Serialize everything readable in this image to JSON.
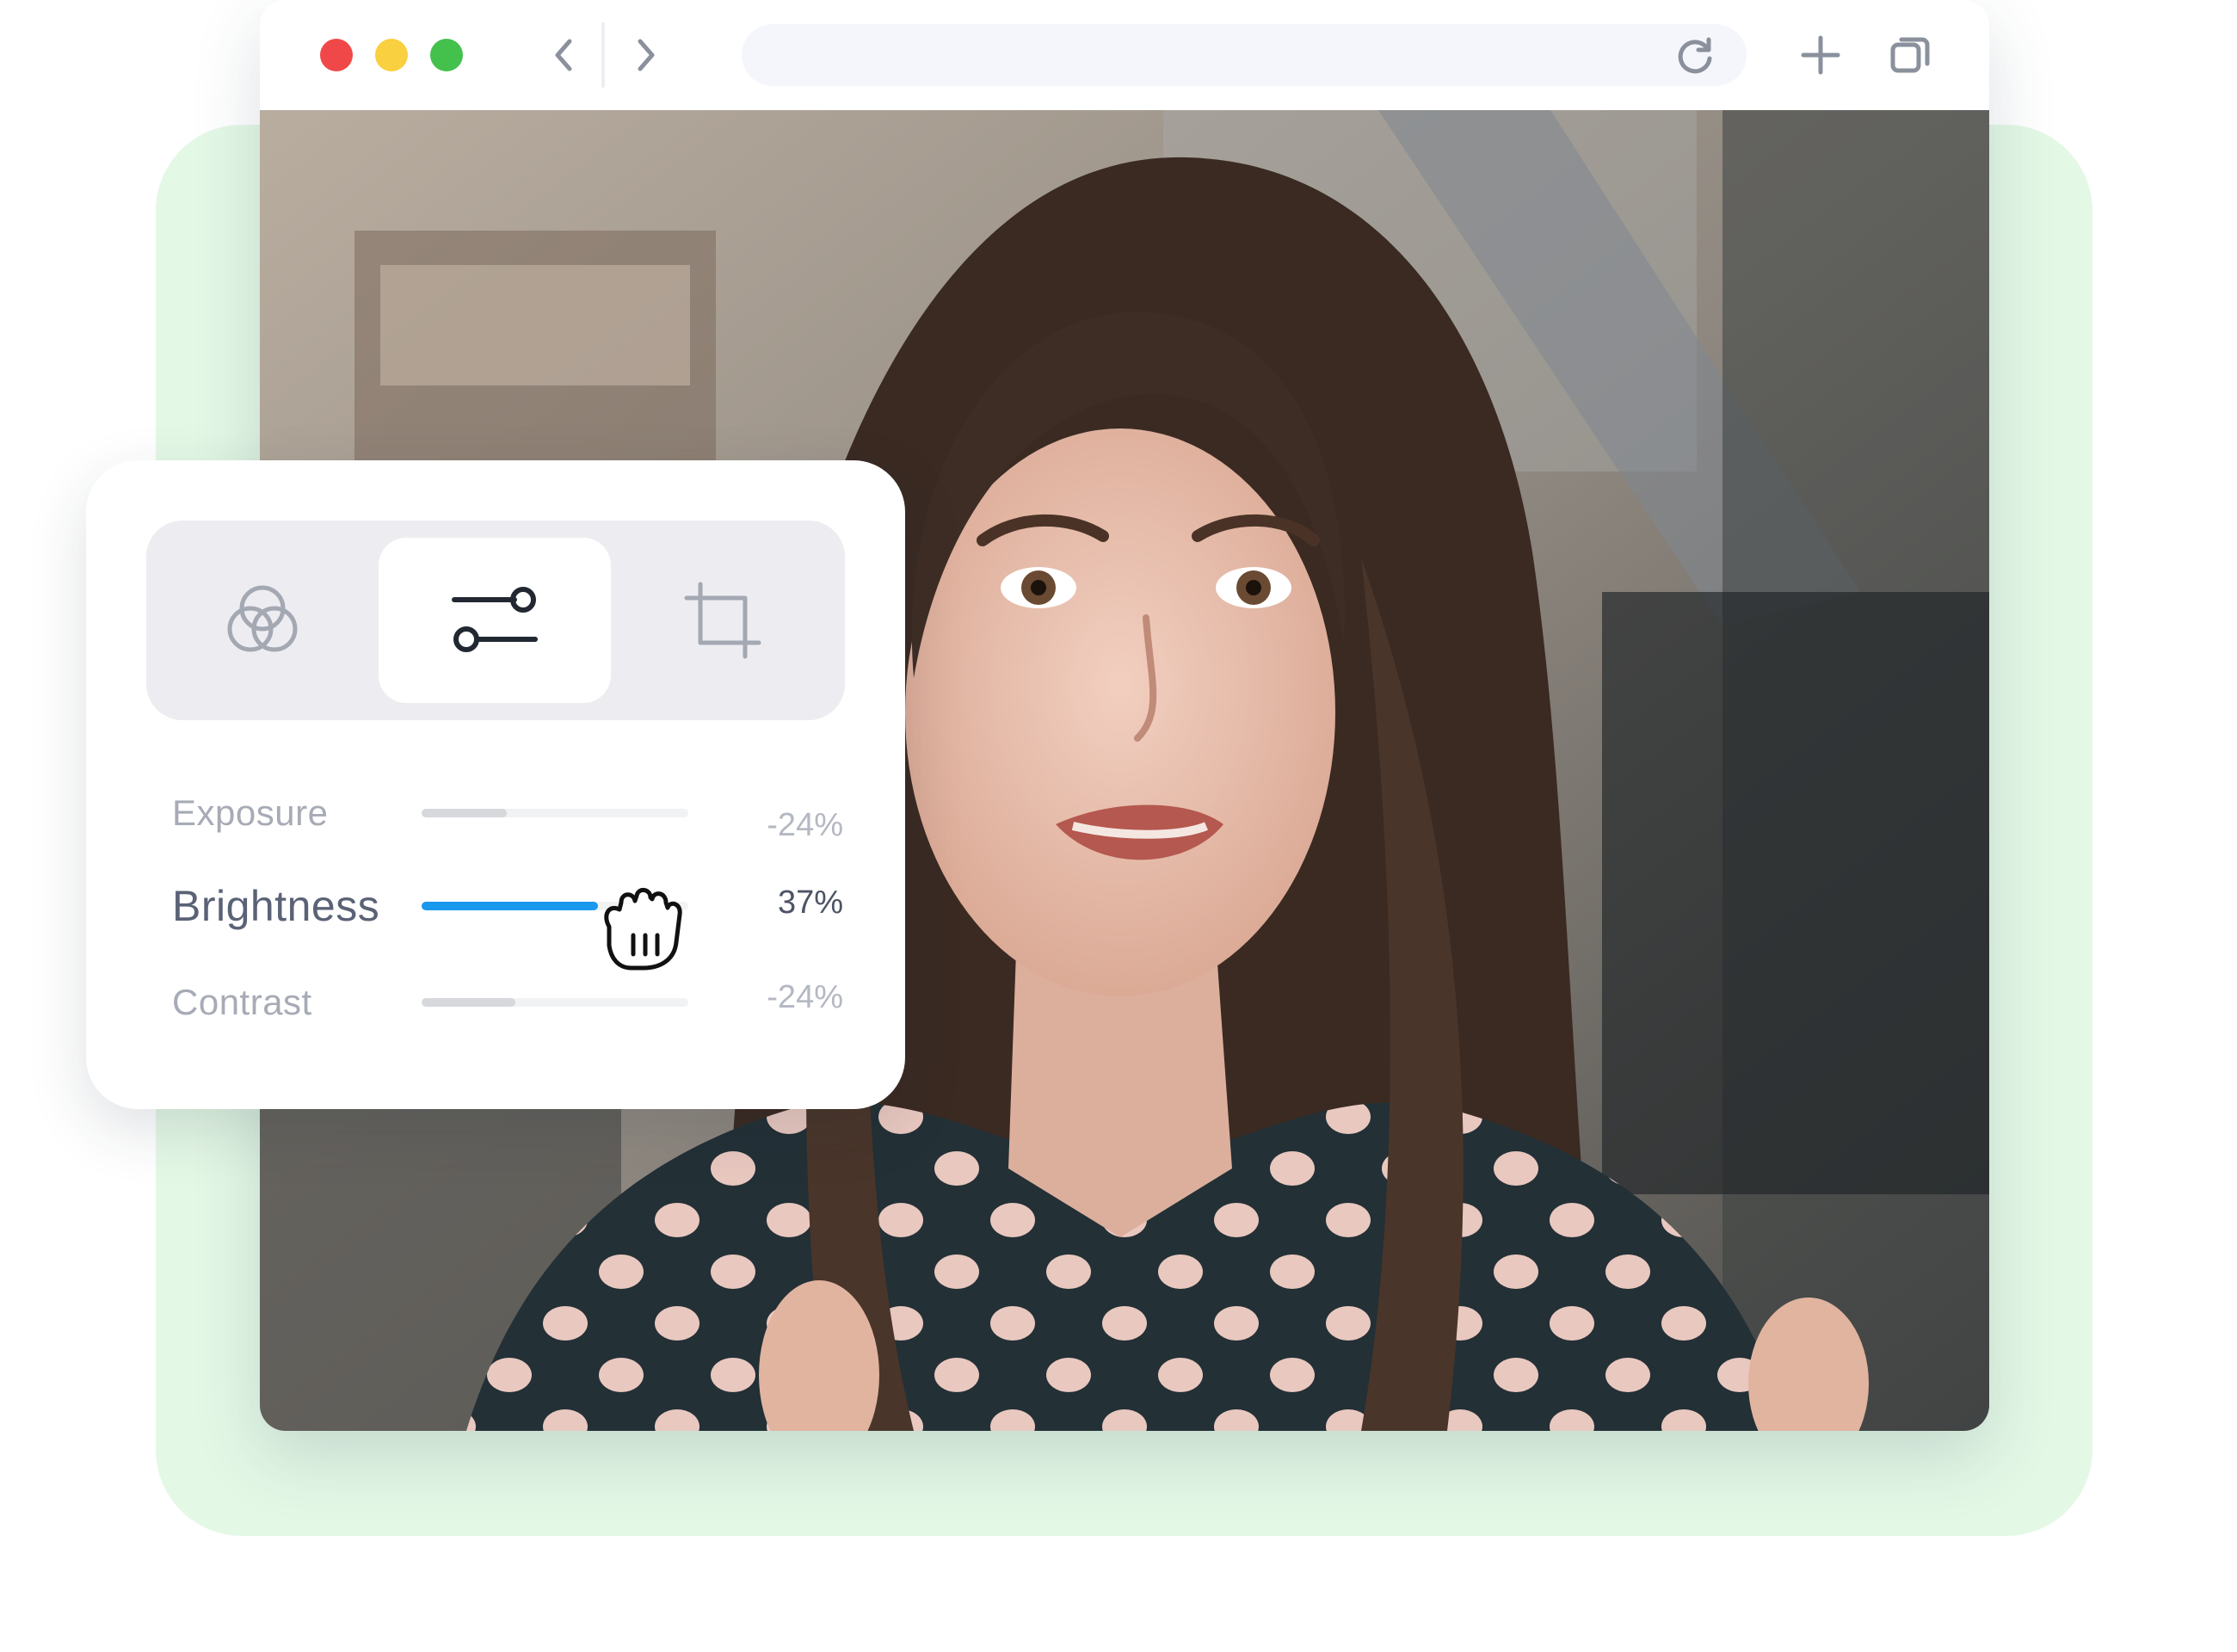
{
  "browser": {
    "traffic_lights": [
      {
        "name": "close",
        "color": "#f04848"
      },
      {
        "name": "minimize",
        "color": "#f8d040"
      },
      {
        "name": "maximize",
        "color": "#44c04c"
      }
    ],
    "icons": {
      "back": "chevron-left-icon",
      "forward": "chevron-right-icon",
      "reload": "reload-icon",
      "new_tab": "plus-icon",
      "tabs": "tabs-icon"
    },
    "address_value": ""
  },
  "editor_panel": {
    "tools": [
      {
        "id": "color",
        "icon": "color-circles-icon",
        "selected": false
      },
      {
        "id": "adjust",
        "icon": "sliders-icon",
        "selected": true
      },
      {
        "id": "crop",
        "icon": "crop-icon",
        "selected": false
      }
    ],
    "adjustments": [
      {
        "label": "Exposure",
        "value": "-24%",
        "level": 0.32
      },
      {
        "label": "Brightness",
        "value": "37%",
        "level": 0.66
      },
      {
        "label": "Contrast",
        "value": "-24%",
        "level": 0.35
      }
    ],
    "accent_color": "#1a98ee"
  },
  "cursor": {
    "icon": "grab-hand-icon"
  },
  "colors": {
    "backdrop": "#e4f8e6",
    "panel": "#ffffff",
    "toolbar": "#ededf1"
  }
}
